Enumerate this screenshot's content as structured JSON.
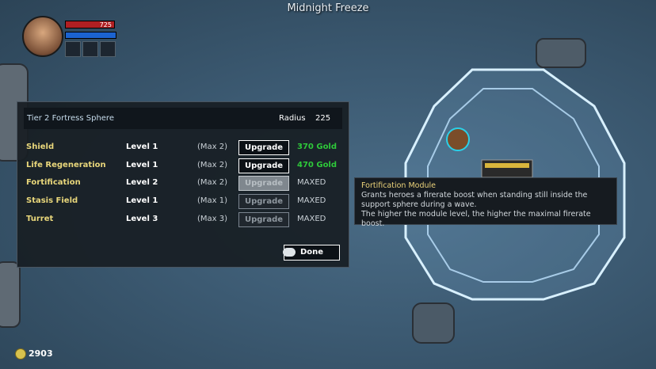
{
  "zone_title": "Midnight Freeze",
  "hud": {
    "hp_value": "725",
    "portrait": "hero-portrait",
    "item_slot_icon": "grenade-icon"
  },
  "panel": {
    "title": "Tier 2 Fortress Sphere",
    "radius_label": "Radius",
    "radius_value": "225",
    "rows": [
      {
        "name": "Shield",
        "level": "Level 1",
        "max": "(Max 2)",
        "button": "Upgrade",
        "cost": "370 Gold",
        "cost_color": "#2ec83a",
        "button_state": "active"
      },
      {
        "name": "Life Regeneration",
        "level": "Level 1",
        "max": "(Max 2)",
        "button": "Upgrade",
        "cost": "470 Gold",
        "cost_color": "#2ec83a",
        "button_state": "active"
      },
      {
        "name": "Fortification",
        "level": "Level 2",
        "max": "(Max 2)",
        "button": "Upgrade",
        "cost": "MAXED",
        "cost_color": "#c9d0d6",
        "button_state": "hover"
      },
      {
        "name": "Stasis Field",
        "level": "Level 1",
        "max": "(Max 1)",
        "button": "Upgrade",
        "cost": "MAXED",
        "cost_color": "#c9d0d6",
        "button_state": "disabled"
      },
      {
        "name": "Turret",
        "level": "Level 3",
        "max": "(Max 3)",
        "button": "Upgrade",
        "cost": "MAXED",
        "cost_color": "#c9d0d6",
        "button_state": "disabled"
      }
    ],
    "done_label": "Done"
  },
  "tooltip": {
    "title": "Fortification Module",
    "line1": "Grants heroes a firerate boost when standing still inside the",
    "line2": "support sphere during a wave.",
    "line3": "The higher the module level, the higher the maximal firerate boost."
  },
  "gold": {
    "amount": "2903",
    "icon": "coin-icon"
  },
  "colors": {
    "sphere": "#bfe3ff",
    "name": "#e9d77b",
    "gold_green": "#2ec83a"
  }
}
